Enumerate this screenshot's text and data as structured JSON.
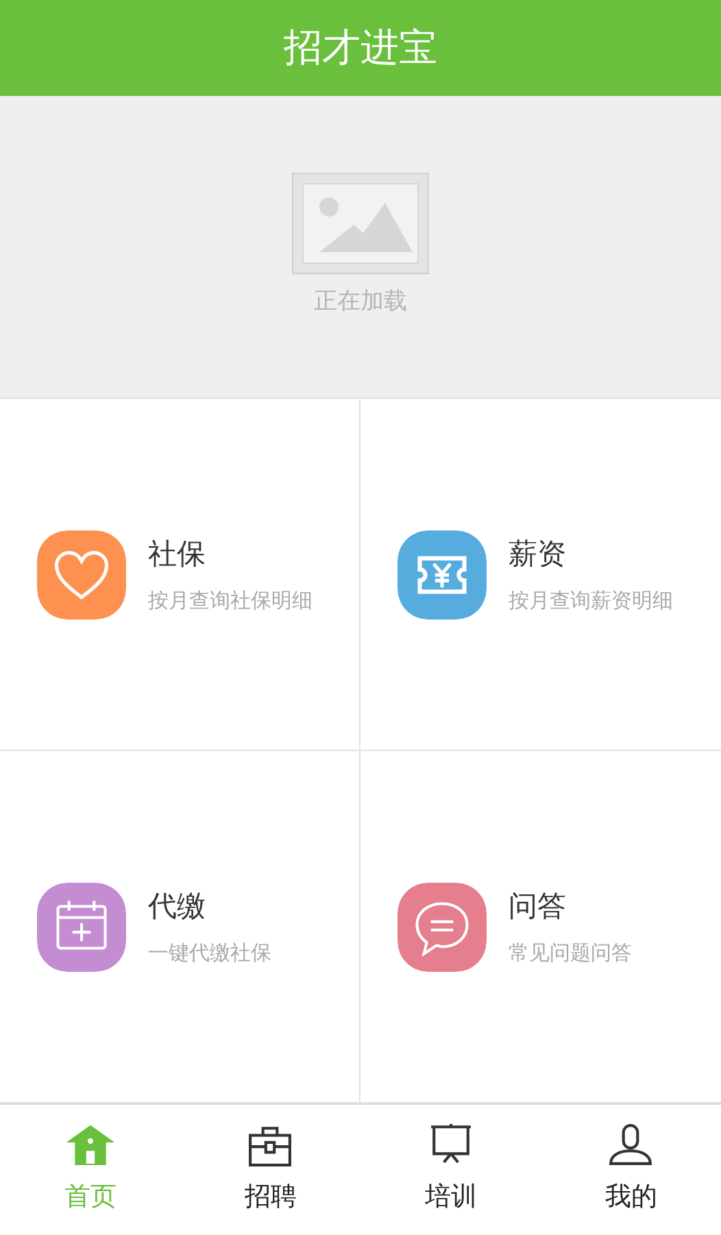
{
  "header": {
    "title": "招才进宝"
  },
  "banner": {
    "loading_text": "正在加载"
  },
  "services": [
    {
      "kind": "heart",
      "title": "社保",
      "subtitle": "按月查询社保明细",
      "color": "#fe9150"
    },
    {
      "kind": "ticket",
      "title": "薪资",
      "subtitle": "按月查询薪资明细",
      "color": "#57acde"
    },
    {
      "kind": "calendar",
      "title": "代缴",
      "subtitle": "一键代缴社保",
      "color": "#c48cd1"
    },
    {
      "kind": "chat",
      "title": "问答",
      "subtitle": "常见问题问答",
      "color": "#e57e8d"
    }
  ],
  "tabs": [
    {
      "kind": "house",
      "label": "首页",
      "selected": true
    },
    {
      "kind": "briefcase",
      "label": "招聘",
      "selected": false
    },
    {
      "kind": "board",
      "label": "培训",
      "selected": false
    },
    {
      "kind": "person",
      "label": "我的",
      "selected": false
    }
  ]
}
